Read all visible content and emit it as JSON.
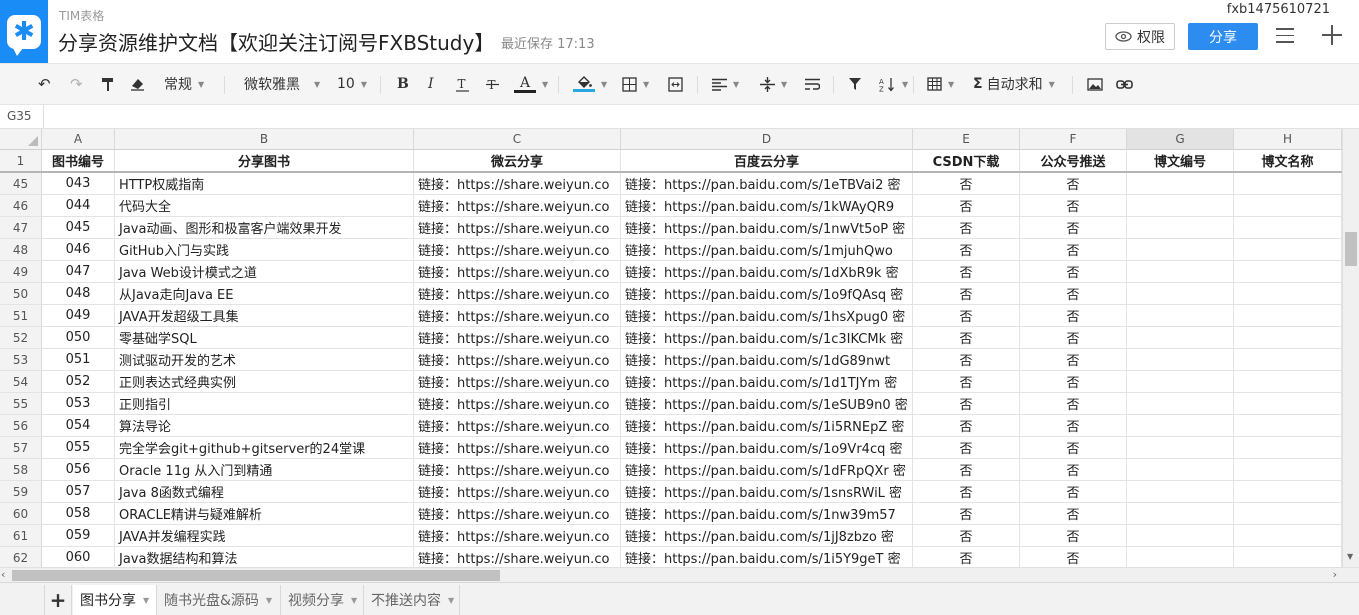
{
  "header": {
    "app_name": "TIM表格",
    "title": "分享资源维护文档【欢迎关注订阅号FXBStudy】",
    "last_save": "最近保存 17:13",
    "user": "fxb1475610721",
    "permission_label": "权限",
    "share_label": "分享"
  },
  "toolbar": {
    "format": "常规",
    "font": "微软雅黑",
    "font_size": "10",
    "autosum": "自动求和",
    "bold": "B",
    "italic": "I",
    "text_color_letter": "A",
    "text_color": "#222222",
    "fill_color": "#29a8e0"
  },
  "namebox": "G35",
  "columns": [
    "A",
    "B",
    "C",
    "D",
    "E",
    "F",
    "G",
    "H"
  ],
  "header_row": {
    "num": "1",
    "cells": [
      "图书编号",
      "分享图书",
      "微云分享",
      "百度云分享",
      "CSDN下载",
      "公众号推送",
      "博文编号",
      "博文名称"
    ]
  },
  "rows": [
    {
      "num": "45",
      "id": "043",
      "name": "HTTP权威指南",
      "weiyun": "链接：https://share.weiyun.co",
      "baidu": "链接：https://pan.baidu.com/s/1eTBVai2 密",
      "csdn": "否",
      "gzh": "否"
    },
    {
      "num": "46",
      "id": "044",
      "name": "代码大全",
      "weiyun": "链接：https://share.weiyun.co",
      "baidu": "链接：https://pan.baidu.com/s/1kWAyQR9",
      "csdn": "否",
      "gzh": "否"
    },
    {
      "num": "47",
      "id": "045",
      "name": "Java动画、图形和极富客户端效果开发",
      "weiyun": "链接：https://share.weiyun.co",
      "baidu": "链接：https://pan.baidu.com/s/1nwVt5oP 密",
      "csdn": "否",
      "gzh": "否"
    },
    {
      "num": "48",
      "id": "046",
      "name": "GitHub入门与实践",
      "weiyun": "链接：https://share.weiyun.co",
      "baidu": "链接：https://pan.baidu.com/s/1mjuhQwo",
      "csdn": "否",
      "gzh": "否"
    },
    {
      "num": "49",
      "id": "047",
      "name": "Java Web设计模式之道",
      "weiyun": "链接：https://share.weiyun.co",
      "baidu": "链接：https://pan.baidu.com/s/1dXbR9k 密",
      "csdn": "否",
      "gzh": "否"
    },
    {
      "num": "50",
      "id": "048",
      "name": "从Java走向Java EE",
      "weiyun": "链接：https://share.weiyun.co",
      "baidu": "链接：https://pan.baidu.com/s/1o9fQAsq 密",
      "csdn": "否",
      "gzh": "否"
    },
    {
      "num": "51",
      "id": "049",
      "name": "JAVA开发超级工具集",
      "weiyun": "链接：https://share.weiyun.co",
      "baidu": "链接：https://pan.baidu.com/s/1hsXpug0 密",
      "csdn": "否",
      "gzh": "否"
    },
    {
      "num": "52",
      "id": "050",
      "name": "零基础学SQL",
      "weiyun": "链接：https://share.weiyun.co",
      "baidu": "链接：https://pan.baidu.com/s/1c3IKCMk 密",
      "csdn": "否",
      "gzh": "否"
    },
    {
      "num": "53",
      "id": "051",
      "name": "测试驱动开发的艺术",
      "weiyun": "链接：https://share.weiyun.co",
      "baidu": "链接：https://pan.baidu.com/s/1dG89nwt",
      "csdn": "否",
      "gzh": "否"
    },
    {
      "num": "54",
      "id": "052",
      "name": "正则表达式经典实例",
      "weiyun": "链接：https://share.weiyun.co",
      "baidu": "链接：https://pan.baidu.com/s/1d1TJYm 密",
      "csdn": "否",
      "gzh": "否"
    },
    {
      "num": "55",
      "id": "053",
      "name": "正则指引",
      "weiyun": "链接：https://share.weiyun.co",
      "baidu": "链接：https://pan.baidu.com/s/1eSUB9n0 密",
      "csdn": "否",
      "gzh": "否"
    },
    {
      "num": "56",
      "id": "054",
      "name": "算法导论",
      "weiyun": "链接：https://share.weiyun.co",
      "baidu": "链接：https://pan.baidu.com/s/1i5RNEpZ 密",
      "csdn": "否",
      "gzh": "否"
    },
    {
      "num": "57",
      "id": "055",
      "name": "完全学会git+github+gitserver的24堂课",
      "weiyun": "链接：https://share.weiyun.co",
      "baidu": "链接：https://pan.baidu.com/s/1o9Vr4cq 密",
      "csdn": "否",
      "gzh": "否"
    },
    {
      "num": "58",
      "id": "056",
      "name": "Oracle 11g 从入门到精通",
      "weiyun": "链接：https://share.weiyun.co",
      "baidu": "链接：https://pan.baidu.com/s/1dFRpQXr 密",
      "csdn": "否",
      "gzh": "否"
    },
    {
      "num": "59",
      "id": "057",
      "name": "Java 8函数式编程",
      "weiyun": "链接：https://share.weiyun.co",
      "baidu": "链接：https://pan.baidu.com/s/1snsRWiL 密",
      "csdn": "否",
      "gzh": "否"
    },
    {
      "num": "60",
      "id": "058",
      "name": "ORACLE精讲与疑难解析",
      "weiyun": "链接：https://share.weiyun.co",
      "baidu": "链接：https://pan.baidu.com/s/1nw39m57",
      "csdn": "否",
      "gzh": "否"
    },
    {
      "num": "61",
      "id": "059",
      "name": "JAVA并发编程实践",
      "weiyun": "链接：https://share.weiyun.co",
      "baidu": "链接：https://pan.baidu.com/s/1jJ8zbzo 密",
      "csdn": "否",
      "gzh": "否"
    },
    {
      "num": "62",
      "id": "060",
      "name": "Java数据结构和算法",
      "weiyun": "链接：https://share.weiyun.co",
      "baidu": "链接：https://pan.baidu.com/s/1i5Y9geT 密",
      "csdn": "否",
      "gzh": "否"
    }
  ],
  "sheets": [
    {
      "label": "图书分享",
      "active": true
    },
    {
      "label": "随书光盘&源码",
      "active": false
    },
    {
      "label": "视频分享",
      "active": false
    },
    {
      "label": "不推送内容",
      "active": false
    }
  ],
  "add_sheet_label": "+",
  "colors": {
    "brand": "#1a8cf5",
    "share_button": "#2d8cf0"
  }
}
